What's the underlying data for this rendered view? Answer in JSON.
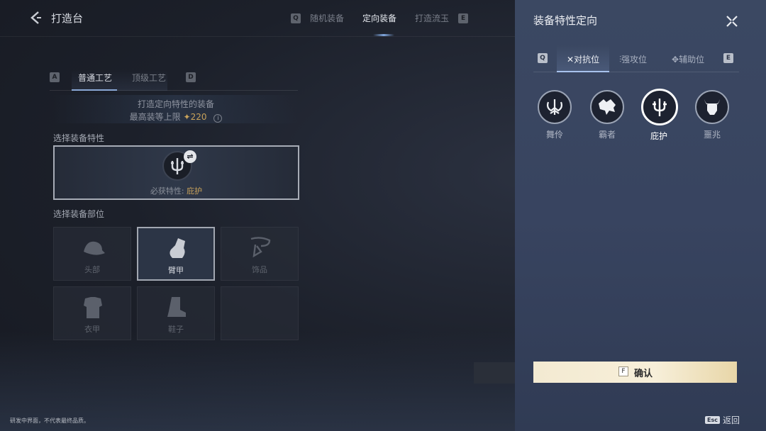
{
  "header": {
    "title": "打造台",
    "key_left": "Q",
    "key_right": "E",
    "tabs": [
      {
        "label": "随机装备"
      },
      {
        "label": "定向装备"
      },
      {
        "label": "打造流玉"
      }
    ],
    "active_tab": "定向装备"
  },
  "craft": {
    "key_left": "A",
    "key_right": "D",
    "tabs": [
      {
        "label": "普通工艺"
      },
      {
        "label": "顶级工艺"
      }
    ],
    "info_line1": "打造定向特性的装备",
    "info_line2_prefix": "最高装等上限",
    "info_line2_value": "✦220",
    "info_icon": "i"
  },
  "trait_section": {
    "label": "选择装备特性",
    "text_prefix": "必获特性: ",
    "text_value": "庇护",
    "swap_icon": "⇌"
  },
  "slot_section": {
    "label": "选择装备部位",
    "slots": [
      {
        "label": "头部",
        "icon": "helmet-icon"
      },
      {
        "label": "臂甲",
        "icon": "gauntlet-icon",
        "selected": true
      },
      {
        "label": "饰品",
        "icon": "necklace-icon"
      },
      {
        "label": "衣甲",
        "icon": "armor-icon"
      },
      {
        "label": "鞋子",
        "icon": "boot-icon"
      }
    ]
  },
  "footer_note": "研发中界面，不代表最终品质。",
  "panel": {
    "title": "装备特性定向",
    "key_left": "Q",
    "key_right": "E",
    "tabs": [
      {
        "label": "对抗位",
        "icon": "crossed-swords-icon"
      },
      {
        "label": "强攻位",
        "icon": "strike-icon"
      },
      {
        "label": "辅助位",
        "icon": "support-icon"
      }
    ],
    "traits": [
      {
        "label": "舞伶",
        "icon": "dancer-icon"
      },
      {
        "label": "霸者",
        "icon": "wolf-icon"
      },
      {
        "label": "庇护",
        "icon": "trident-icon",
        "selected": true
      },
      {
        "label": "噩兆",
        "icon": "horned-skull-icon"
      }
    ],
    "confirm_key": "F",
    "confirm_label": "确认",
    "esc_key": "Esc",
    "back_label": "返回"
  },
  "colors": {
    "accent_gold": "#c8a25a",
    "panel_bg": "#3a4661",
    "confirm_bg": "#f3ead2"
  }
}
